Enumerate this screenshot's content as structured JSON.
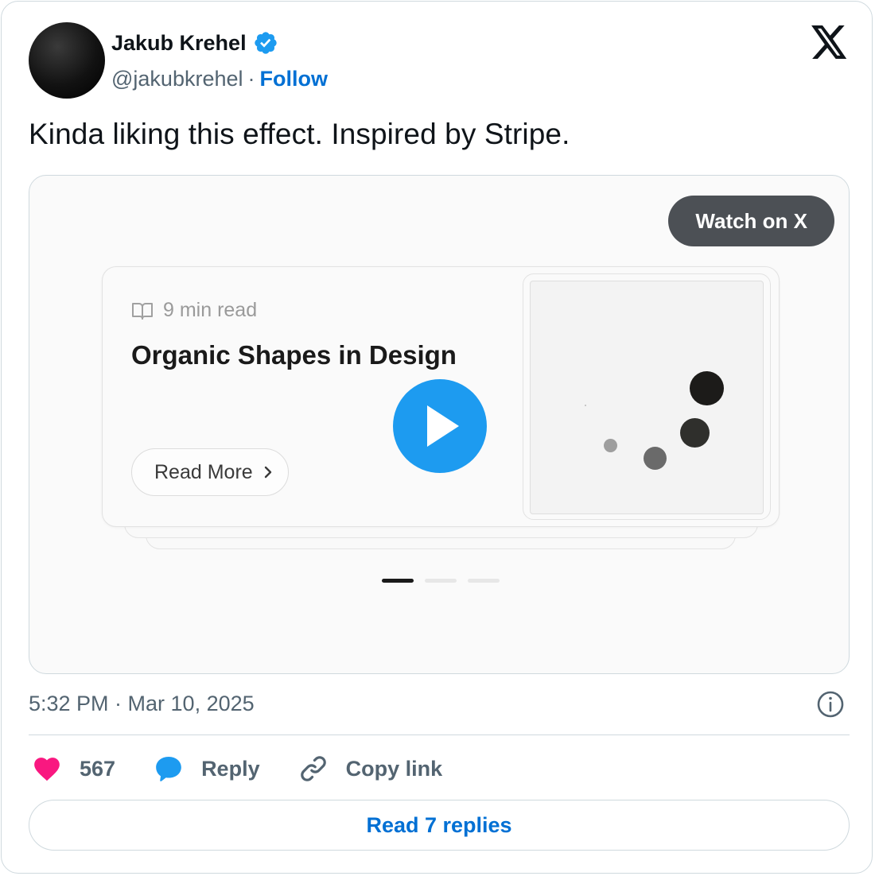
{
  "author": {
    "name": "Jakub Krehel",
    "handle": "@jakubkrehel",
    "separator": "·",
    "follow_label": "Follow",
    "verified": true
  },
  "icons": {
    "verified": "verified-badge-icon",
    "brand": "x-logo-icon",
    "info": "info-icon",
    "like": "heart-icon",
    "reply": "speech-bubble-icon",
    "copy": "link-icon",
    "book": "book-icon",
    "chevron": "chevron-right-icon",
    "play": "play-icon"
  },
  "tweet": {
    "text": "Kinda liking this effect. Inspired by Stripe.",
    "timestamp": "5:32 PM · Mar 10, 2025"
  },
  "media": {
    "watch_label": "Watch on X",
    "card": {
      "read_time": "9 min read",
      "title": "Organic Shapes in Design",
      "cta_label": "Read More"
    },
    "pager": {
      "count": 3,
      "active_index": 0
    }
  },
  "actions": {
    "likes_count": "567",
    "reply_label": "Reply",
    "copy_label": "Copy link"
  },
  "replies_button": "Read 7 replies",
  "colors": {
    "link_blue": "#0070d4",
    "play_blue": "#1d9bf0",
    "heart_pink": "#f91880",
    "watch_bg": "#4c5055",
    "muted_text": "#536471"
  }
}
